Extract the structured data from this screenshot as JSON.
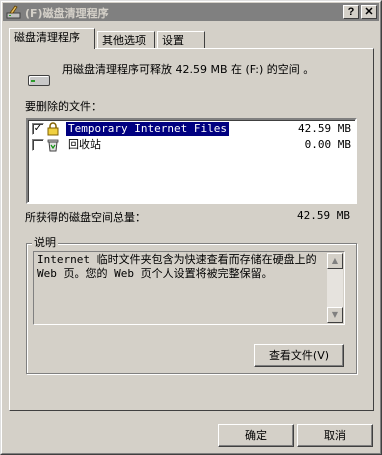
{
  "window": {
    "title": "(F)磁盘清理程序",
    "help_button": "?",
    "close_button": "✕"
  },
  "tabs": [
    {
      "label": "磁盘清理程序"
    },
    {
      "label": "其他选项"
    },
    {
      "label": "设置"
    }
  ],
  "summary": {
    "text": "用磁盘清理程序可释放 42.59 MB 在 (F:) 的空间 。",
    "files_label": "要删除的文件："
  },
  "files": [
    {
      "name": "Temporary Internet Files",
      "size": "42.59 MB",
      "checked": true,
      "icon": "lock-folder-icon"
    },
    {
      "name": "回收站",
      "size": "0.00 MB",
      "checked": false,
      "icon": "recycle-bin-icon"
    }
  ],
  "total": {
    "label": "所获得的磁盘空间总量：",
    "value": "42.59 MB"
  },
  "description": {
    "label": "说明",
    "text": "Internet 临时文件夹包含为快速查看而存储在硬盘上的 Web 页。您的 Web 页个人设置将被完整保留。",
    "view_files_button": "查看文件(V)"
  },
  "buttons": {
    "ok": "确定",
    "cancel": "取消"
  }
}
